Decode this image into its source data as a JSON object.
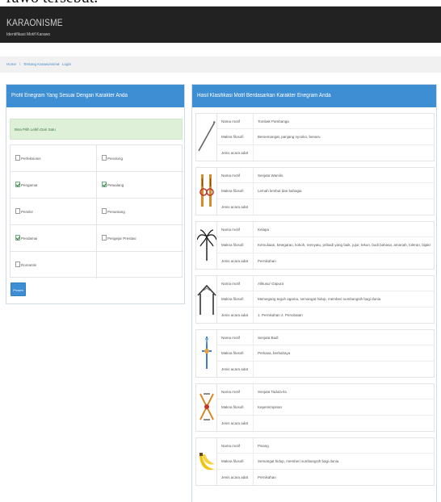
{
  "caption": "rawo tersebut.",
  "header": {
    "title": "KARAONISME",
    "subtitle": "Identifikasi Motif Karawo"
  },
  "breadcrumb": {
    "home": "Home",
    "sep": "/",
    "about": "Tentang Karawonisme",
    "login": "Login"
  },
  "left_panel": {
    "title": "Profil Enegram Yang Sesuai Dengan Karakter Anda",
    "notice": "Bisa Pilih Lebih Dari Satu",
    "options": [
      {
        "label": "Perfeksionis",
        "checked": false
      },
      {
        "label": "Penolong",
        "checked": false
      },
      {
        "label": "Pengamat",
        "checked": true
      },
      {
        "label": "Petualang",
        "checked": true
      },
      {
        "label": "Pemikir",
        "checked": false
      },
      {
        "label": "Penantang",
        "checked": false
      },
      {
        "label": "Pendamai",
        "checked": true
      },
      {
        "label": "Pengejar Prestasi",
        "checked": false
      },
      {
        "label": "Romantis",
        "checked": false
      }
    ],
    "submit_label": "Proses"
  },
  "right_panel": {
    "title": "Hasil Klasifikasi Motif Berdasarkan Karakter Enegram Anda",
    "keys": {
      "name": "Nama motif",
      "meaning": "Makna filosofi",
      "type": "Jenis acara adat"
    },
    "motifs": [
      {
        "icon": "tombak-motif-icon",
        "name": "Tombak Pambanga",
        "meaning": "Bersemangat, panjang nyonko, benaru",
        "type": ""
      },
      {
        "icon": "senjata-motif-icon",
        "name": "Senjata Wamilo",
        "meaning": "Lemah lembut dan bahagia",
        "type": ""
      },
      {
        "icon": "kelapa-motif-icon",
        "name": "Kelapa",
        "meaning": "Kemuliaan, ketegaran, kokoh, menyatu, pribadi yang baik, jujur, tekun, budi bahasa, amanah, toleran, bijaksana, berbagi",
        "type": "Pernikahan"
      },
      {
        "icon": "gapura-motif-icon",
        "name": "Alikusu/ Gapura",
        "meaning": "Memegang teguh agama, semangat hidup, memberi sumbangsih bagi dunia",
        "type": "1. Pernikahan 2. Penobatan"
      },
      {
        "icon": "senjata-badi-motif-icon",
        "name": "Senjata Badi",
        "meaning": "Perkasa, berbahaya",
        "type": ""
      },
      {
        "icon": "tadula-motif-icon",
        "name": "Senjata Tadula-ila",
        "meaning": "Kepemimpinan",
        "type": ""
      },
      {
        "icon": "pisang-motif-icon",
        "name": "Pisang",
        "meaning": "Semangat hidup, memberi sumbangsih bagi dunia",
        "type": "Pernikahan"
      }
    ]
  }
}
